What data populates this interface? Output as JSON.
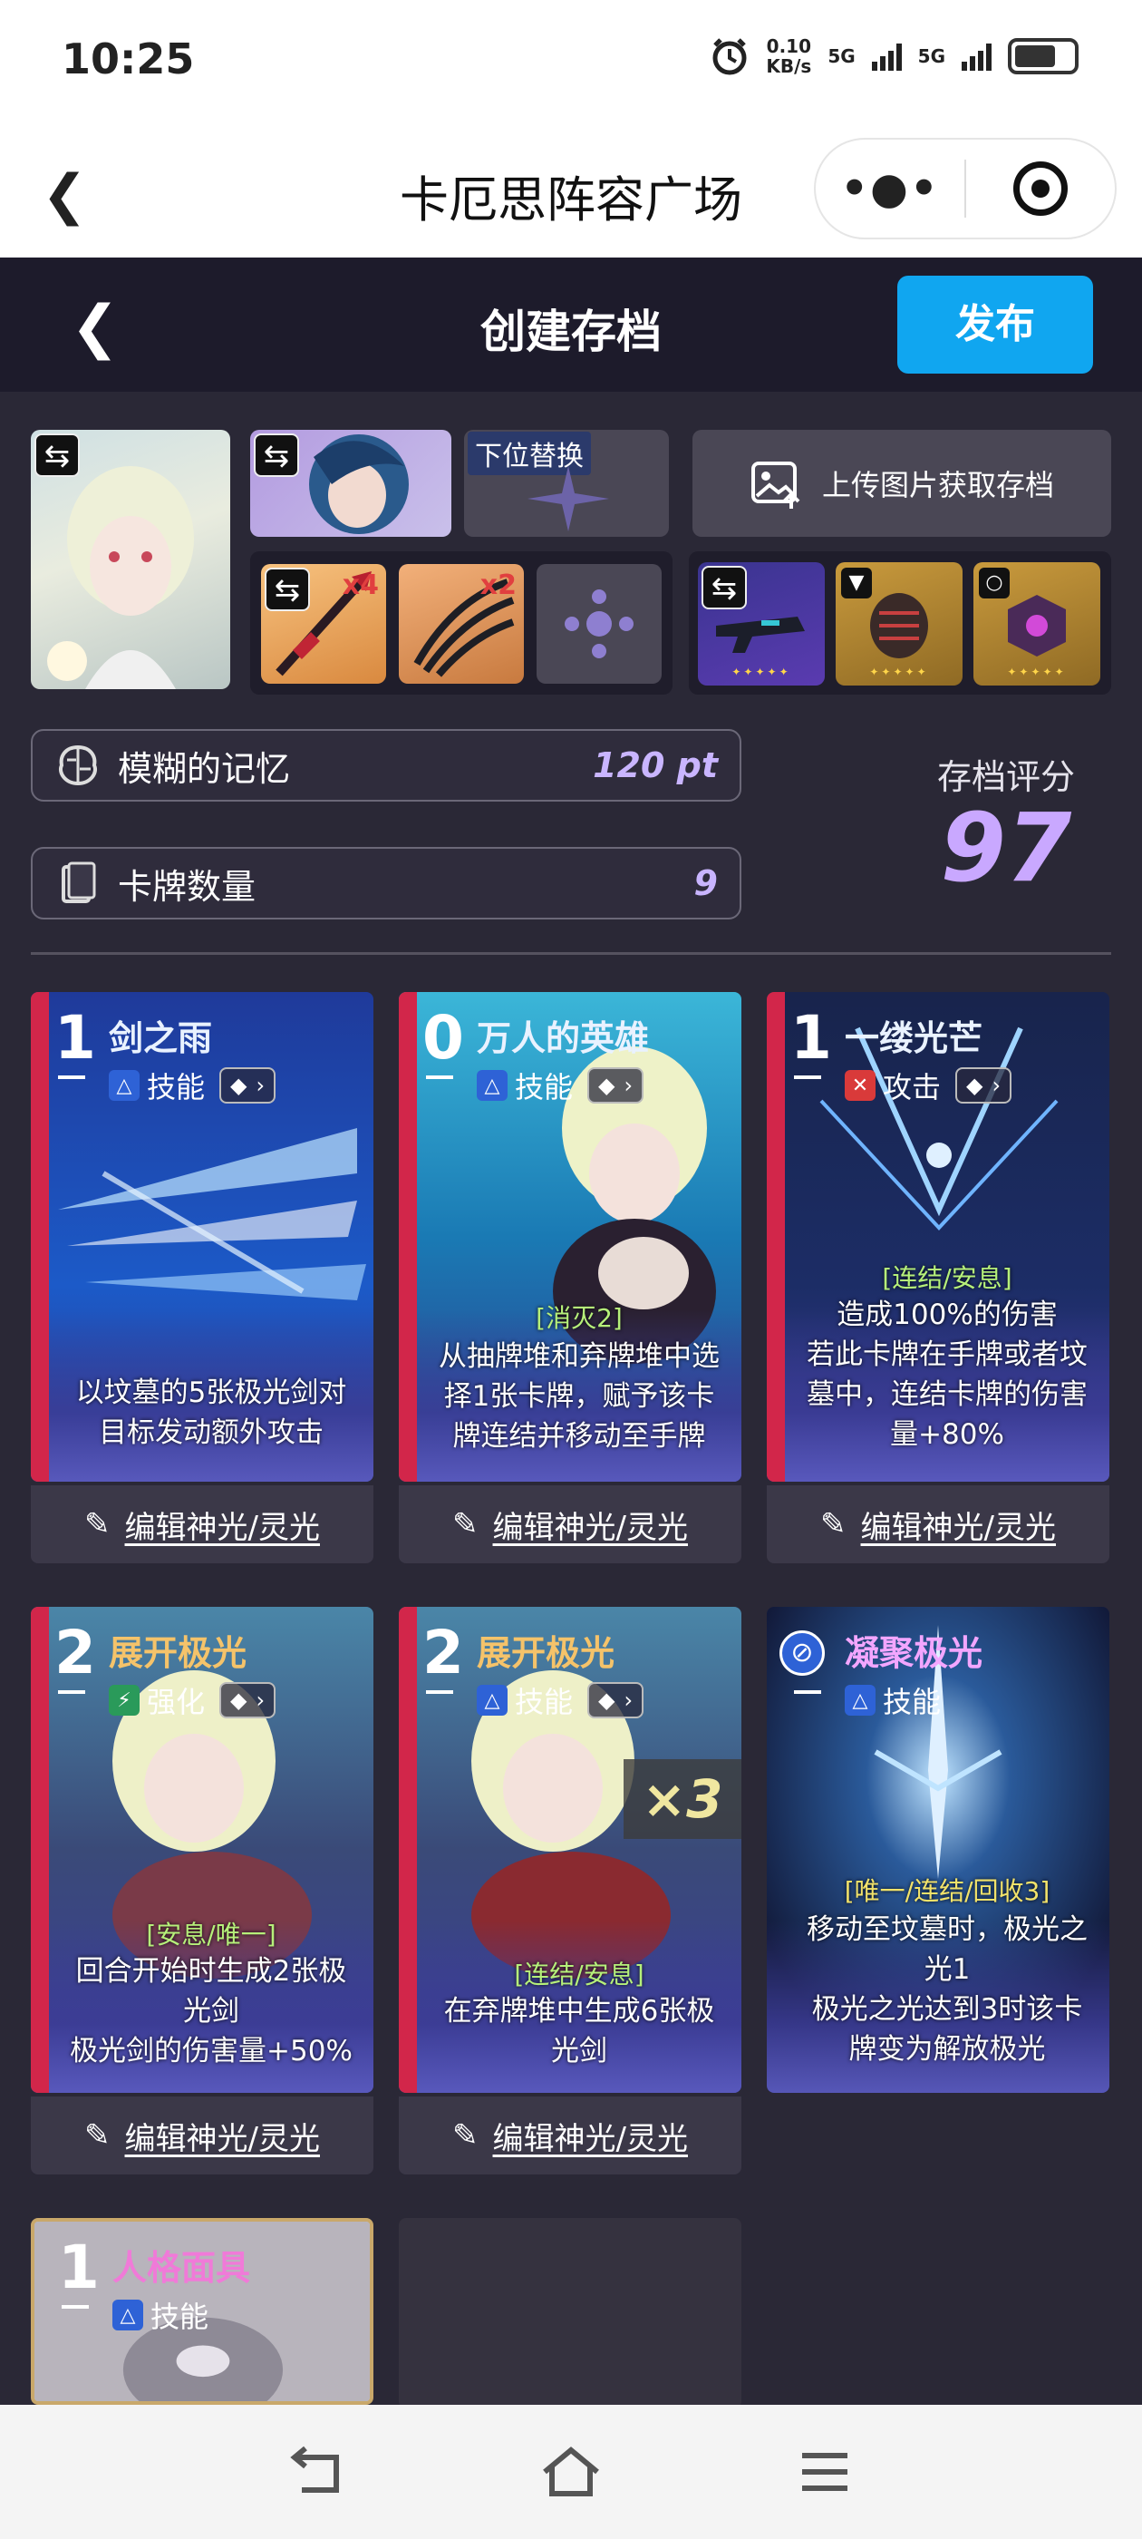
{
  "status_bar": {
    "time": "10:25",
    "speed_value": "0.10",
    "speed_unit": "KB/s",
    "net1": "5G",
    "net2": "5G"
  },
  "mini_app": {
    "title": "卡厄思阵容广场"
  },
  "header": {
    "title": "创建存档",
    "publish_label": "发布"
  },
  "loadout": {
    "alt_label": "下位替换",
    "upload_label": "上传图片获取存档",
    "weapon1_qty": "x4",
    "weapon2_qty": "x2"
  },
  "stats": {
    "memory_label": "模糊的记忆",
    "memory_value": "120 pt",
    "card_count_label": "卡牌数量",
    "card_count_value": "9",
    "score_label": "存档评分",
    "score_value": "97"
  },
  "edit_label": "编辑神光/灵光",
  "cards": [
    {
      "cost": "1",
      "name": "剑之雨",
      "type": "技能",
      "desc1": "以坟墓的5张极光剑对",
      "desc2": "目标发动额外攻击"
    },
    {
      "cost": "0",
      "name": "万人的英雄",
      "type": "技能",
      "tag": "[消灭2]",
      "desc1": "从抽牌堆和弃牌堆中选",
      "desc2": "择1张卡牌，赋予该卡",
      "desc3": "牌连结并移动至手牌"
    },
    {
      "cost": "1",
      "name": "一缕光芒",
      "type": "攻击",
      "tag": "[连结/安息]",
      "desc1": "造成100%的伤害",
      "desc2": "若此卡牌在手牌或者坟",
      "desc3": "墓中，连结卡牌的伤害",
      "desc4": "量+80%"
    },
    {
      "cost": "2",
      "name": "展开极光",
      "type": "强化",
      "tag": "[安息/唯一]",
      "desc1": "回合开始时生成2张极",
      "desc2": "光剑",
      "desc3": "极光剑的伤害量+50%"
    },
    {
      "cost": "2",
      "name": "展开极光",
      "type": "技能",
      "mult": "×3",
      "tag": "[连结/安息]",
      "desc1": "在弃牌堆中生成6张极",
      "desc2": "光剑"
    },
    {
      "cost": "",
      "name": "凝聚极光",
      "type": "技能",
      "tag": "[唯一/连结/回收3]",
      "desc1": "移动至坟墓时，极光之",
      "desc2": "光1",
      "desc3": "极光之光达到3时该卡",
      "desc4": "牌变为解放极光"
    },
    {
      "cost": "1",
      "name": "人格面具",
      "type": "技能"
    }
  ],
  "colors": {
    "accent": "#10a6f0",
    "score": "#c9a8ff",
    "background": "#2a2836"
  }
}
